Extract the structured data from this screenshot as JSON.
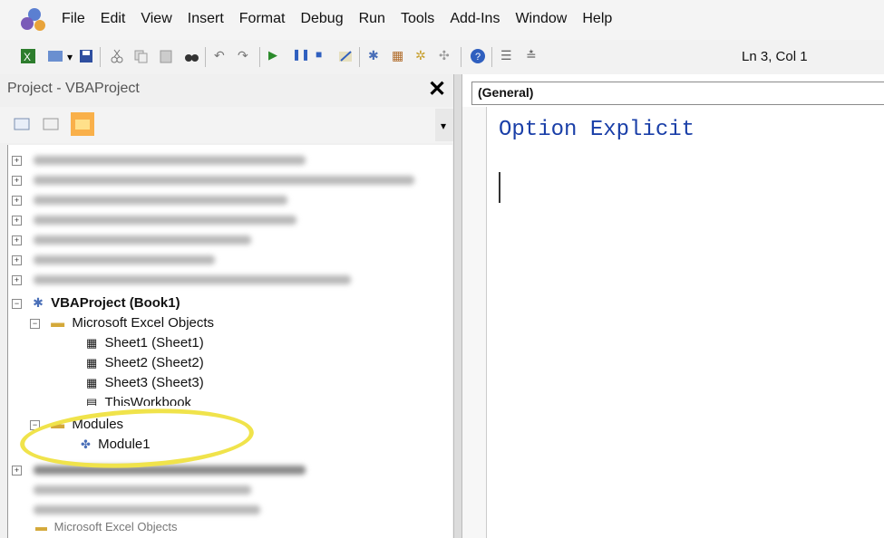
{
  "menu": [
    "File",
    "Edit",
    "View",
    "Insert",
    "Format",
    "Debug",
    "Run",
    "Tools",
    "Add-Ins",
    "Window",
    "Help"
  ],
  "toolbar": {
    "status": "Ln 3, Col 1"
  },
  "project": {
    "title": "Project - VBAProject",
    "close": "✕",
    "root": "VBAProject (Book1)",
    "excel_objects": "Microsoft Excel Objects",
    "sheets": [
      "Sheet1 (Sheet1)",
      "Sheet2 (Sheet2)",
      "Sheet3 (Sheet3)"
    ],
    "thisworkbook": "ThisWorkbook",
    "modules": "Modules",
    "module1": "Module1",
    "bottom_item": "Microsoft Excel Objects"
  },
  "code": {
    "dropdown": "(General)",
    "line1": "Option Explicit"
  },
  "colors": {
    "highlight": "#f0e34b",
    "code_text": "#1a3fa8"
  }
}
